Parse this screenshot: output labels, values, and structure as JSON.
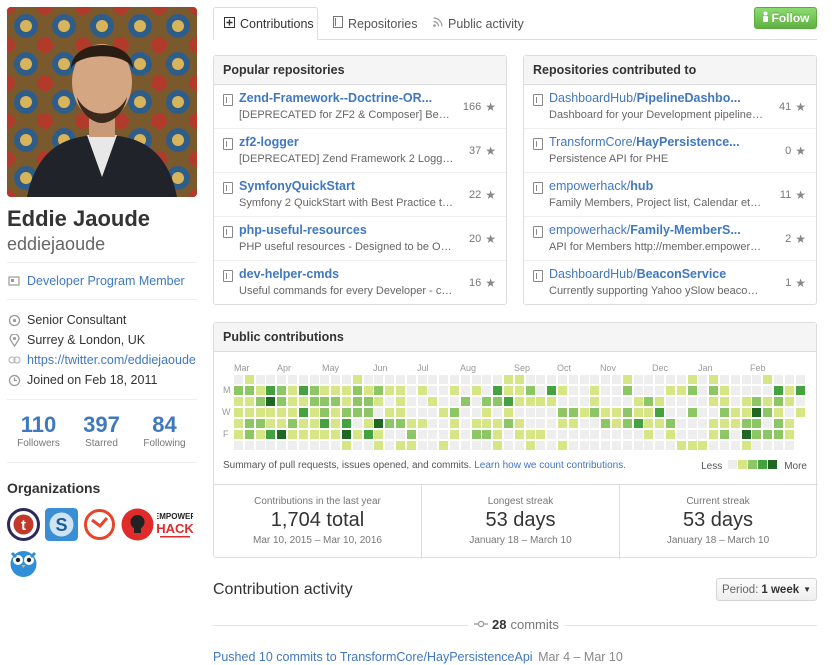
{
  "profile": {
    "fullname": "Eddie Jaoude",
    "username": "eddiejaoude",
    "program": "Developer Program Member",
    "job": "Senior Consultant",
    "location": "Surrey & London, UK",
    "website": "https://twitter.com/eddiejaoude",
    "joined": "Joined on Feb 18, 2011",
    "stats": [
      {
        "num": "110",
        "label": "Followers"
      },
      {
        "num": "397",
        "label": "Starred"
      },
      {
        "num": "84",
        "label": "Following"
      }
    ]
  },
  "organizations": {
    "title": "Organizations",
    "items": [
      {
        "icon": "t-org-logo",
        "letter": "t"
      },
      {
        "icon": "s-org-logo",
        "letter": "S"
      },
      {
        "icon": "swirl-org-logo",
        "letter": ""
      },
      {
        "icon": "bulb-org-logo",
        "letter": ""
      },
      {
        "icon": "empowerhack-logo",
        "text1": "EMPOWER",
        "text2": "HACK"
      },
      {
        "icon": "owl-org-logo",
        "letter": ""
      }
    ]
  },
  "tabs": [
    {
      "label": "Contributions",
      "icon": "plus-square-icon",
      "active": true
    },
    {
      "label": "Repositories",
      "icon": "book-icon",
      "active": false
    },
    {
      "label": "Public activity",
      "icon": "rss-icon",
      "active": false
    }
  ],
  "follow_label": "Follow",
  "popular": {
    "title": "Popular repositories",
    "repos": [
      {
        "owner": "",
        "name": "Zend-Framework--Doctrine-OR...",
        "desc": "[DEPRECATED for ZF2 & Composer] Best pr...",
        "stars": "166"
      },
      {
        "owner": "",
        "name": "zf2-logger",
        "desc": "[DEPRECATED] Zend Framework 2 Logger - l...",
        "stars": "37"
      },
      {
        "owner": "",
        "name": "SymfonyQuickStart",
        "desc": "Symfony 2 QuickStart with Best Practice tools ...",
        "stars": "22"
      },
      {
        "owner": "",
        "name": "php-useful-resources",
        "desc": "PHP useful resources - Designed to be Object...",
        "stars": "20"
      },
      {
        "owner": "",
        "name": "dev-helper-cmds",
        "desc": "Useful commands for every Developer - comp...",
        "stars": "16"
      }
    ]
  },
  "contributed": {
    "title": "Repositories contributed to",
    "repos": [
      {
        "owner": "DashboardHub/",
        "name": "PipelineDashbo...",
        "desc": "Dashboard for your Development pipeline. Fo...",
        "stars": "41"
      },
      {
        "owner": "TransformCore/",
        "name": "HayPersistence...",
        "desc": "Persistence API for PHE",
        "stars": "0"
      },
      {
        "owner": "empowerhack/",
        "name": "hub",
        "desc": "Family Members, Project list, Calendar etc...",
        "stars": "11"
      },
      {
        "owner": "empowerhack/",
        "name": "Family-MemberS...",
        "desc": "API for Members http://member.empowerhack.io",
        "stars": "2"
      },
      {
        "owner": "DashboardHub/",
        "name": "BeaconService",
        "desc": "Currently supporting Yahoo ySlow beaconing ...",
        "stars": "1"
      }
    ]
  },
  "contributions": {
    "title": "Public contributions",
    "months": [
      "Mar",
      "Apr",
      "May",
      "Jun",
      "Jul",
      "Aug",
      "Sep",
      "Oct",
      "Nov",
      "Dec",
      "Jan",
      "Feb"
    ],
    "days": [
      "M",
      "W",
      "F"
    ],
    "summary": "Summary of pull requests, issues opened, and commits.",
    "summary_link": "Learn how we count contributions.",
    "less": "Less",
    "more": "More",
    "colors": [
      "#eeeeee",
      "#d6e685",
      "#8cc665",
      "#44a340",
      "#1e6823"
    ],
    "stats": [
      {
        "label": "Contributions in the last year",
        "value": "1,704 total",
        "range": "Mar 10, 2015 – Mar 10, 2016"
      },
      {
        "label": "Longest streak",
        "value": "53 days",
        "range": "January 18 – March 10"
      },
      {
        "label": "Current streak",
        "value": "53 days",
        "range": "January 18 – March 10"
      }
    ]
  },
  "activity": {
    "title": "Contribution activity",
    "period_label": "Period:",
    "period_value": "1 week",
    "commits_count": "28",
    "commits_word": "commits",
    "pushed_text": "Pushed 10 commits to TransformCore/HayPersistenceApi",
    "pushed_date": "Mar 4 – Mar 10"
  }
}
